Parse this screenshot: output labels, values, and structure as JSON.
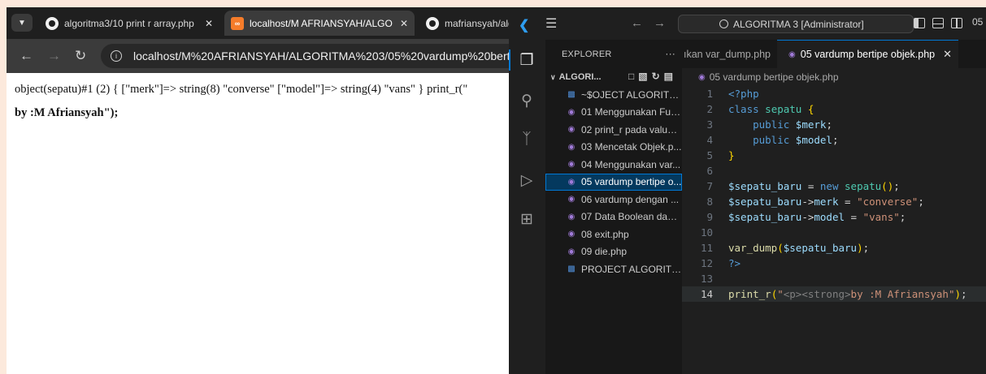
{
  "browser": {
    "tabs": [
      {
        "title": "algoritma3/10 print r array.php",
        "icon": "github-icon"
      },
      {
        "title": "localhost/M AFRIANSYAH/ALGO",
        "icon": "xampp-icon",
        "active": true
      },
      {
        "title": "mafriansyah/alg",
        "icon": "github-icon"
      }
    ],
    "url": "localhost/M%20AFRIANSYAH/ALGORITMA%203/05%20vardump%20bertipe%",
    "output_line1": "object(sepatu)#1 (2) { [\"merk\"]=> string(8) \"converse\" [\"model\"]=> string(4) \"vans\" } print_r(\"",
    "output_line2": "by :M Afriansyah\");"
  },
  "vscode": {
    "search_text": "ALGORITMA 3 [Administrator]",
    "title_trunc": "05",
    "explorer": {
      "header": "EXPLORER",
      "more": "···",
      "root": "ALGORI...",
      "items": [
        {
          "label": "~$OJECT ALGORITM...",
          "icon": "workspace-file-icon"
        },
        {
          "label": "01 Menggunakan Fun...",
          "icon": "php-file-icon"
        },
        {
          "label": "02 print_r pada value....",
          "icon": "php-file-icon"
        },
        {
          "label": "03 Mencetak Objek.p...",
          "icon": "php-file-icon"
        },
        {
          "label": "04 Menggunakan var...",
          "icon": "php-file-icon"
        },
        {
          "label": "05 vardump bertipe o...",
          "icon": "php-file-icon",
          "selected": true
        },
        {
          "label": "06 vardump dengan ...",
          "icon": "php-file-icon"
        },
        {
          "label": "07 Data Boolean dan ...",
          "icon": "php-file-icon"
        },
        {
          "label": "08 exit.php",
          "icon": "php-file-icon"
        },
        {
          "label": "09 die.php",
          "icon": "php-file-icon"
        },
        {
          "label": "PROJECT ALGORITMA...",
          "icon": "workspace-file-icon"
        }
      ]
    },
    "editor": {
      "tabs": [
        {
          "label": "ıkan var_dump.php"
        },
        {
          "label": "05 vardump bertipe objek.php",
          "active": true
        }
      ],
      "breadcrumb": "05 vardump bertipe objek.php",
      "current_line": 14
    }
  }
}
